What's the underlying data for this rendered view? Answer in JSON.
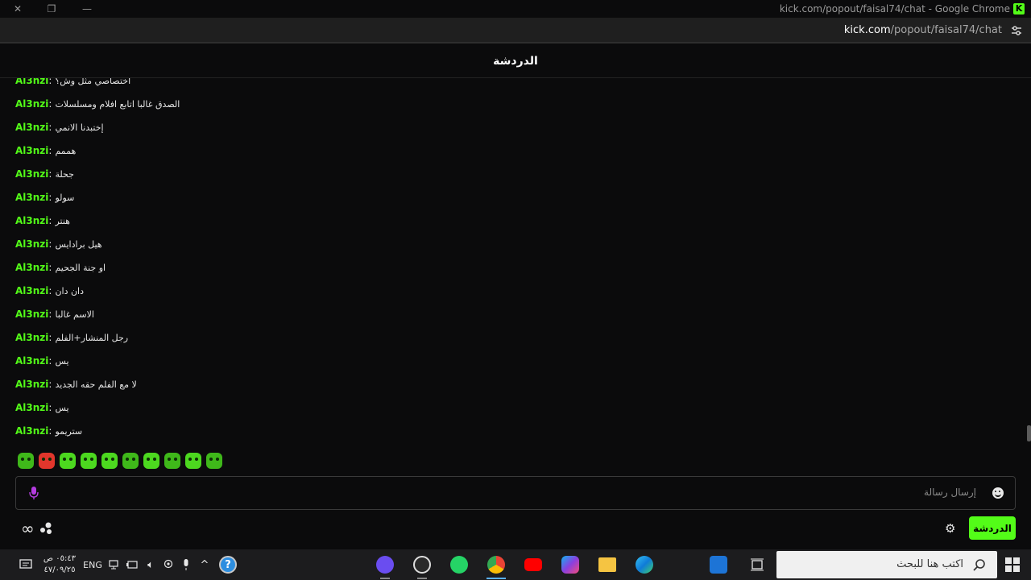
{
  "window": {
    "title": "kick.com/popout/faisal74/chat - Google Chrome",
    "favicon_letter": "K",
    "controls": {
      "close": "✕",
      "restore": "❐",
      "minimize": "—"
    }
  },
  "urlbar": {
    "domain": "kick.com",
    "path": "/popout/faisal74/chat"
  },
  "chat": {
    "title": "الدردشة",
    "messages": [
      {
        "user": "Al3nzi",
        "text": "اختصاصي مثل وش؟"
      },
      {
        "user": "Al3nzi",
        "text": "الصدق غالبا اتابع افلام ومسلسلات"
      },
      {
        "user": "Al3nzi",
        "text": "إختبدنا الانمي"
      },
      {
        "user": "Al3nzi",
        "text": "هممم"
      },
      {
        "user": "Al3nzi",
        "text": "جحلة"
      },
      {
        "user": "Al3nzi",
        "text": "سولو"
      },
      {
        "user": "Al3nzi",
        "text": "هنتر"
      },
      {
        "user": "Al3nzi",
        "text": "هيل برادايس"
      },
      {
        "user": "Al3nzi",
        "text": "او جنة الجحيم"
      },
      {
        "user": "Al3nzi",
        "text": "دان دان"
      },
      {
        "user": "Al3nzi",
        "text": "الاسم غالبا"
      },
      {
        "user": "Al3nzi",
        "text": "رجل المنشار+الفلم"
      },
      {
        "user": "Al3nzi",
        "text": "يس"
      },
      {
        "user": "Al3nzi",
        "text": "لا مع الفلم حقه الجديد"
      },
      {
        "user": "Al3nzi",
        "text": "يس"
      },
      {
        "user": "Al3nzi",
        "text": "ستريمو"
      }
    ],
    "emotes": [
      "green-emote",
      "red-emote",
      "green-emote",
      "green-emote",
      "green-emote",
      "green-emote",
      "green-emote",
      "green-emote",
      "green-emote",
      "green-emote"
    ],
    "input_placeholder": "إرسال رسالة",
    "send_tab_label": "الدردشة",
    "infinity_glyph": "∞"
  },
  "taskbar": {
    "time": "٠٥:٤٣ ص",
    "date": "٤٧/٠٩/٢٥",
    "language": "ENG",
    "search_placeholder": "اكتب هنا للبحث",
    "apps": [
      "obs-icon",
      "chrome-icon",
      "whatsapp-icon",
      "youtube-icon",
      "m365-icon",
      "file-explorer-icon",
      "edge-icon",
      "mail-icon",
      "task-view-icon"
    ]
  },
  "colors": {
    "accent": "#53fc18",
    "background": "#0b0b0c"
  }
}
